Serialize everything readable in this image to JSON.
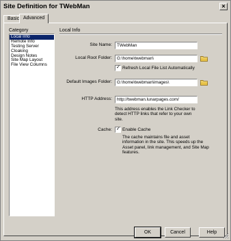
{
  "window": {
    "title": "Site Definition for TWebMan",
    "close_glyph": "×"
  },
  "tabs": [
    {
      "label": "Basic",
      "selected": false
    },
    {
      "label": "Advanced",
      "selected": true
    }
  ],
  "category": {
    "label": "Category",
    "items": [
      {
        "label": "Local Info",
        "selected": true
      },
      {
        "label": "Remote Info",
        "selected": false
      },
      {
        "label": "Testing Server",
        "selected": false
      },
      {
        "label": "Cloaking",
        "selected": false
      },
      {
        "label": "Design Notes",
        "selected": false
      },
      {
        "label": "Site Map Layout",
        "selected": false
      },
      {
        "label": "File View Columns",
        "selected": false
      }
    ]
  },
  "local_info": {
    "section_title": "Local Info",
    "site_name": {
      "label": "Site Name:",
      "value": "TWebMan"
    },
    "local_root_folder": {
      "label": "Local Root Folder:",
      "value": "G:\\home\\twebman\\"
    },
    "refresh_local": {
      "label": "Refresh Local File List Automatically",
      "checked": true
    },
    "default_images_folder": {
      "label": "Default Images Folder:",
      "value": "G:\\home\\twebman\\images\\"
    },
    "http_address": {
      "label": "HTTP Address:",
      "value": "http://twebman.lunarpages.com/",
      "help_lines": [
        "This address enables the Link Checker to",
        "detect HTTP links that refer to your own",
        "site."
      ]
    },
    "cache": {
      "label": "Cache:",
      "checkbox_label": "Enable Cache",
      "checked": true,
      "help_lines": [
        "The cache maintains file and asset",
        "information in the site. This speeds up the",
        "Asset panel, link management, and Site Map",
        "features."
      ]
    }
  },
  "buttons": {
    "ok": "OK",
    "cancel": "Cancel",
    "help": "Help"
  },
  "icons": {
    "folder": "folder-icon",
    "checkmark": "✓"
  },
  "colors": {
    "dialog_face": "#d4d0c8",
    "selection": "#0a246a",
    "folder_yellow": "#e8c34a"
  }
}
